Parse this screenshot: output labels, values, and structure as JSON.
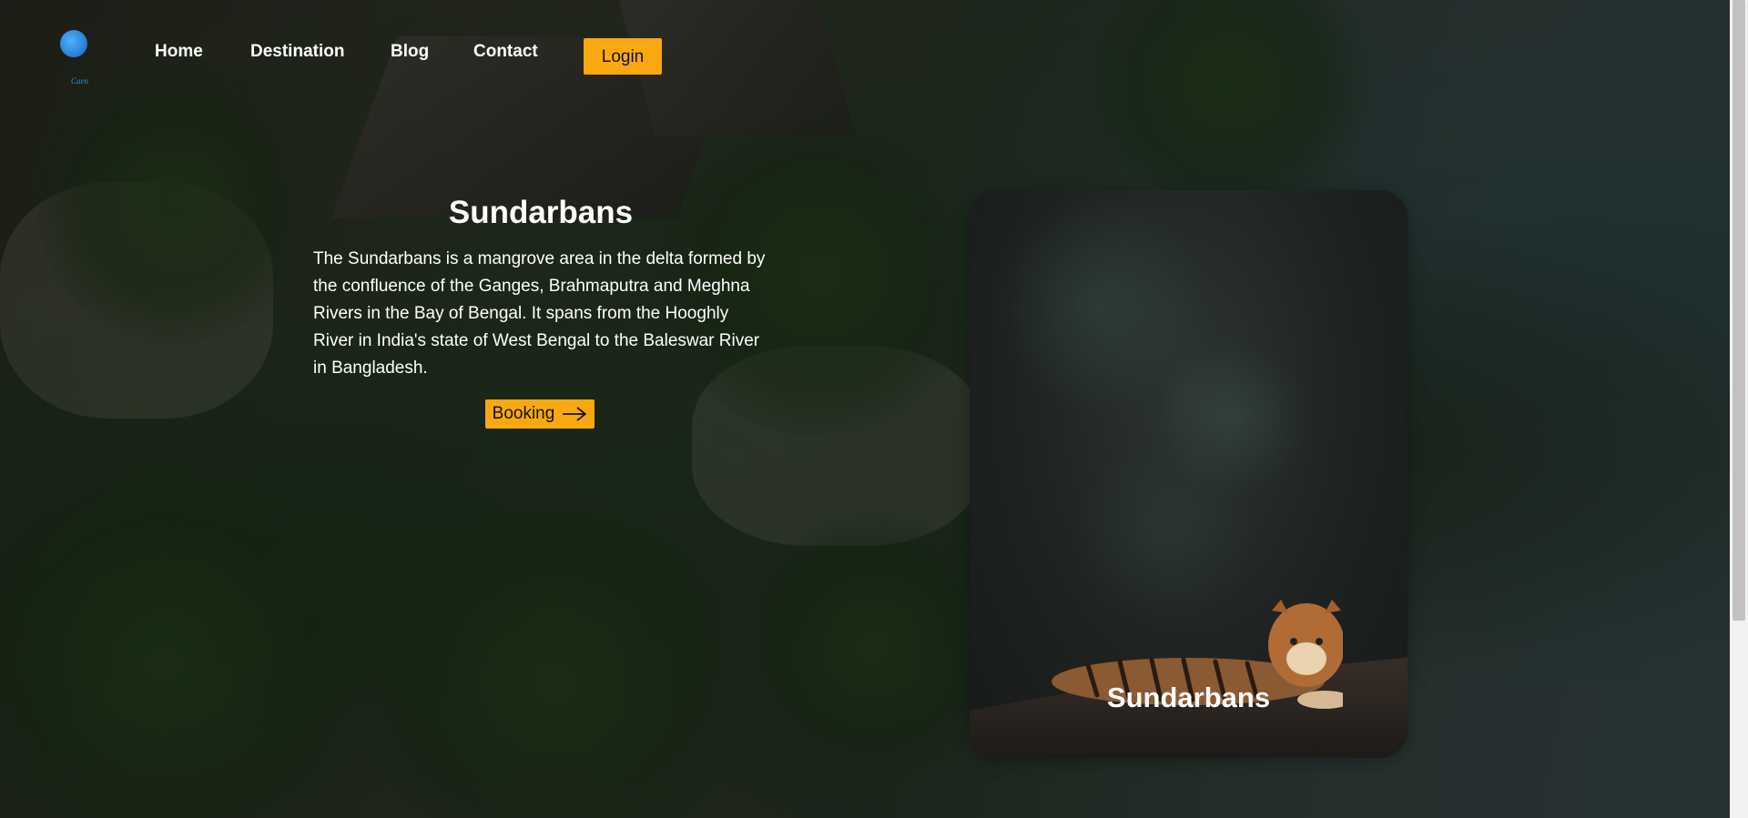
{
  "nav": {
    "logo_text": "Caen",
    "links": [
      {
        "label": "Home"
      },
      {
        "label": "Destination"
      },
      {
        "label": "Blog"
      },
      {
        "label": "Contact"
      }
    ],
    "login_label": "Login"
  },
  "hero": {
    "title": "Sundarbans",
    "description": "The Sundarbans is a mangrove area in the delta formed by the confluence of the Ganges, Brahmaputra and Meghna Rivers in the Bay of Bengal. It spans from the Hooghly River in India's state of West Bengal to the Baleswar River in Bangladesh.",
    "booking_label": "Booking",
    "booking_icon": "arrow-right-icon"
  },
  "card": {
    "title": "Sundarbans"
  },
  "colors": {
    "accent": "#f9a80f",
    "text": "#ffffff"
  }
}
